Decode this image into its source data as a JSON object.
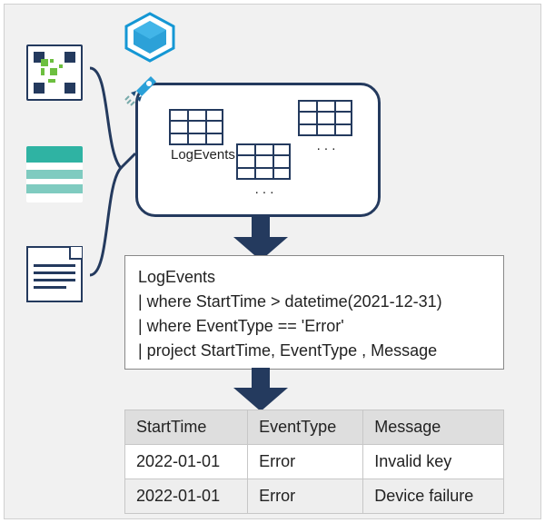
{
  "sources": {
    "loader_icon": "telemetry-ingest-icon",
    "table_icon": "stored-rows-icon",
    "document_icon": "document-icon"
  },
  "container": {
    "tables": [
      {
        "label": "LogEvents"
      },
      {
        "label": ". . ."
      },
      {
        "label": ". . ."
      }
    ]
  },
  "query": {
    "lines": [
      "LogEvents",
      "| where StartTime > datetime(2021-12-31)",
      "| where EventType == 'Error'",
      "| project StartTime, EventType , Message"
    ]
  },
  "result": {
    "columns": [
      "StartTime",
      "EventType",
      "Message"
    ],
    "rows": [
      [
        "2022-01-01",
        "Error",
        "Invalid key"
      ],
      [
        "2022-01-01",
        "Error",
        "Device failure"
      ]
    ]
  }
}
